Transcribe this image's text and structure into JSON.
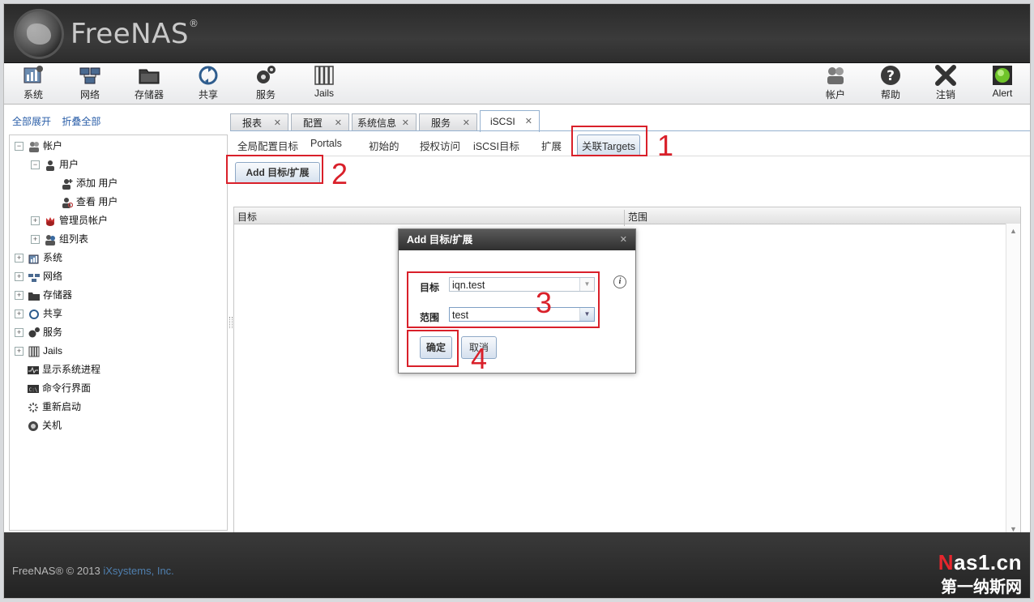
{
  "header": {
    "logo_text": "FreeNAS",
    "logo_mark": "®"
  },
  "toolbar": {
    "left": [
      {
        "label": "系统",
        "icon": "system-icon"
      },
      {
        "label": "网络",
        "icon": "network-icon"
      },
      {
        "label": "存储器",
        "icon": "storage-icon"
      },
      {
        "label": "共享",
        "icon": "sharing-icon"
      },
      {
        "label": "服务",
        "icon": "services-icon"
      },
      {
        "label": "Jails",
        "icon": "jails-icon"
      }
    ],
    "right": [
      {
        "label": "帐户",
        "icon": "account-icon"
      },
      {
        "label": "帮助",
        "icon": "help-icon"
      },
      {
        "label": "注销",
        "icon": "logout-icon"
      },
      {
        "label": "Alert",
        "icon": "alert-icon",
        "color": "#6fc42a"
      }
    ]
  },
  "sidebar": {
    "expand_all": "全部展开",
    "collapse_all": "折叠全部",
    "tree": [
      {
        "label": "帐户",
        "level": 0,
        "toggle": "−"
      },
      {
        "label": "用户",
        "level": 1,
        "toggle": "−"
      },
      {
        "label": "添加 用户",
        "level": 2
      },
      {
        "label": "查看 用户",
        "level": 2
      },
      {
        "label": "管理员帐户",
        "level": 1,
        "toggle": "+"
      },
      {
        "label": "组列表",
        "level": 1,
        "toggle": "+"
      },
      {
        "label": "系统",
        "level": 0,
        "toggle": "+"
      },
      {
        "label": "网络",
        "level": 0,
        "toggle": "+"
      },
      {
        "label": "存储器",
        "level": 0,
        "toggle": "+"
      },
      {
        "label": "共享",
        "level": 0,
        "toggle": "+"
      },
      {
        "label": "服务",
        "level": 0,
        "toggle": "+"
      },
      {
        "label": "Jails",
        "level": 0,
        "toggle": "+"
      },
      {
        "label": "显示系统进程",
        "level": 0
      },
      {
        "label": "命令行界面",
        "level": 0
      },
      {
        "label": "重新启动",
        "level": 0
      },
      {
        "label": "关机",
        "level": 0
      }
    ]
  },
  "tabs": [
    {
      "label": "报表",
      "close": "✕"
    },
    {
      "label": "配置",
      "close": "✕"
    },
    {
      "label": "系统信息",
      "close": "✕"
    },
    {
      "label": "服务",
      "close": "✕"
    },
    {
      "label": "iSCSI",
      "close": "✕",
      "active": true
    }
  ],
  "subtabs": [
    "全局配置目标",
    "Portals",
    "初始的",
    "授权访问",
    "iSCSI目标",
    "扩展",
    "关联Targets"
  ],
  "add_button": "Add 目标/扩展",
  "grid": {
    "columns": [
      "目标",
      "范围"
    ]
  },
  "dialog": {
    "title": "Add 目标/扩展",
    "close": "✕",
    "target_label": "目标",
    "target_value": "iqn.test",
    "extent_label": "范围",
    "extent_value": "test",
    "ok": "确定",
    "cancel": "取消",
    "info": "i"
  },
  "annotations": [
    "1",
    "2",
    "3",
    "4"
  ],
  "footer": {
    "copyright": "FreeNAS® © 2013 ",
    "company": "iXsystems, Inc."
  },
  "watermark": {
    "site_n": "N",
    "site_rest": "as1.cn",
    "tagline": "第一纳斯网"
  },
  "colors": {
    "annotation_red": "#d9202a",
    "link_blue": "#2a5ea8",
    "alert_green": "#6fc42a"
  }
}
